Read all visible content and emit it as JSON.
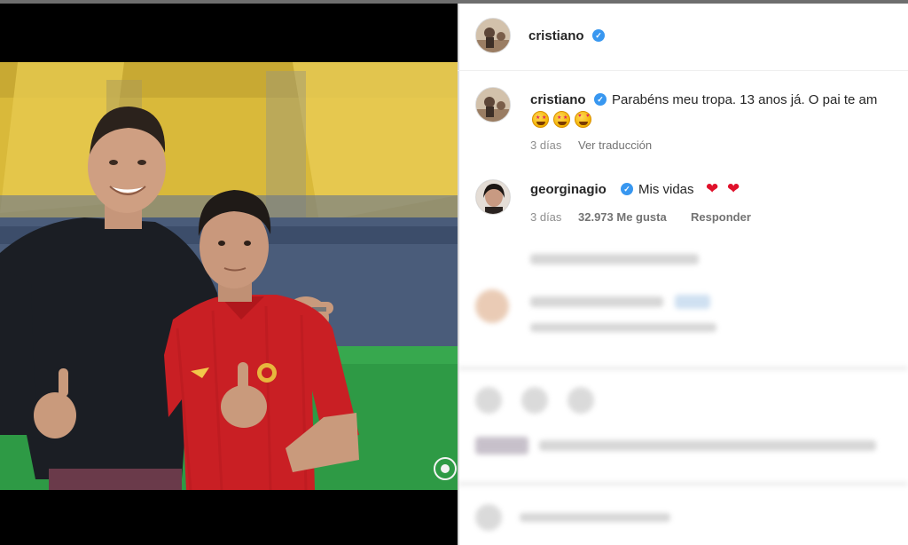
{
  "header": {
    "username": "cristiano",
    "verified": true
  },
  "caption": {
    "username": "cristiano",
    "text": "Parabéns meu tropa. 13 anos já. O pai te am",
    "emojis": [
      "star-struck-emoji",
      "star-struck-emoji",
      "smiling-face-with-hearts-emoji"
    ],
    "time": "3 días",
    "translate": "Ver traducción"
  },
  "comment": {
    "username": "georginagio",
    "text": "Mis vidas",
    "hearts": [
      "❤",
      "❤"
    ],
    "time": "3 días",
    "likes": "32.973 Me gusta",
    "reply": "Responder"
  },
  "colors": {
    "verified": "#3897f0",
    "heart": "#e0112b",
    "jersey": "#c91f24",
    "pitch": "#2e9a45",
    "stands": "#e5c33b"
  }
}
